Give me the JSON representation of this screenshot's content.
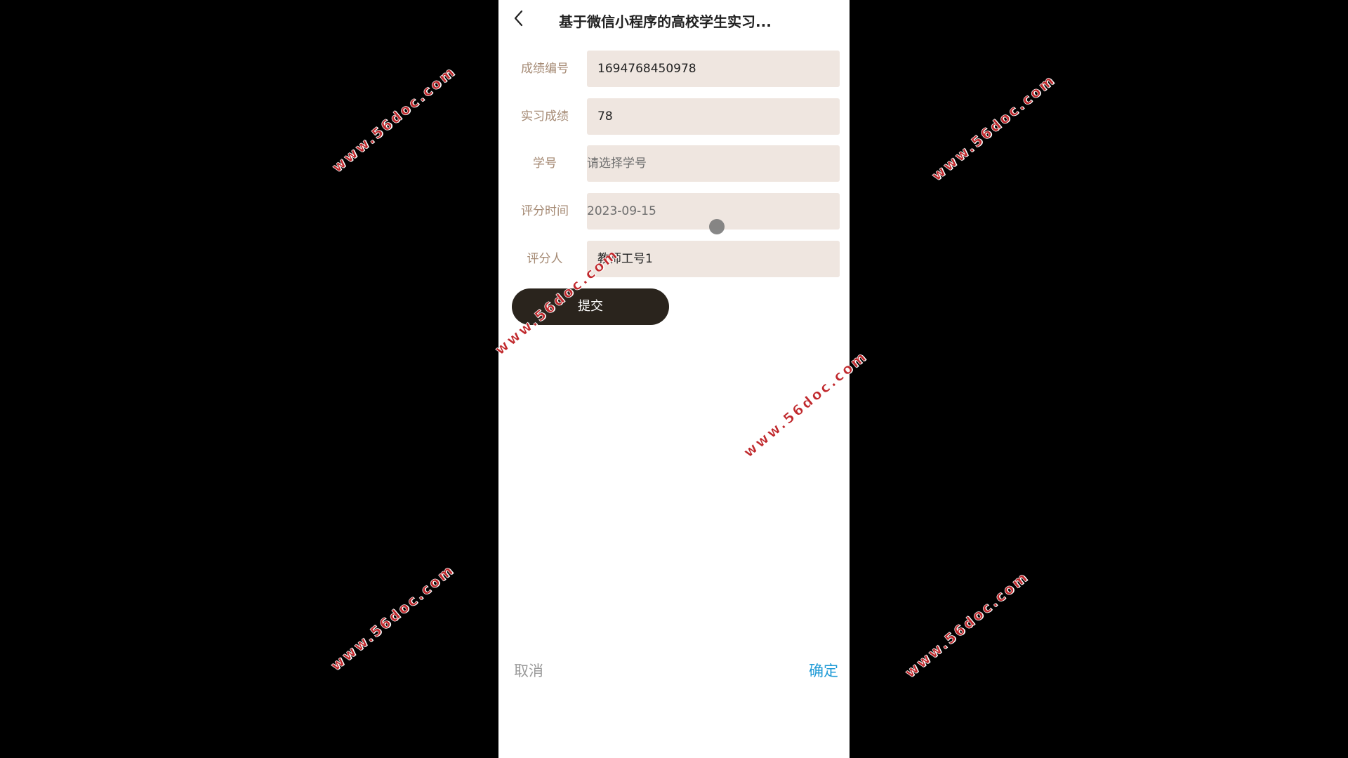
{
  "navbar": {
    "title": "基于微信小程序的高校学生实习..."
  },
  "form": {
    "grade_id_label": "成绩编号",
    "grade_id_value": "1694768450978",
    "internship_score_label": "实习成绩",
    "internship_score_value": "78",
    "student_id_label": "学号",
    "student_id_placeholder": "请选择学号",
    "score_time_label": "评分时间",
    "score_time_value": "2023-09-15",
    "scorer_label": "评分人",
    "scorer_value": "教师工号1",
    "submit_label": "提交"
  },
  "picker": {
    "cancel_label": "取消",
    "confirm_label": "确定"
  },
  "watermark": {
    "text": "www.56doc.com"
  },
  "colors": {
    "label": "#a58a74",
    "field_bg": "#efe6e0",
    "submit_bg": "#2a241d",
    "confirm": "#1e9ad6",
    "cancel": "#9a9a9a",
    "watermark": "#c0282c"
  },
  "icons": {
    "back": "chevron-left-icon"
  }
}
